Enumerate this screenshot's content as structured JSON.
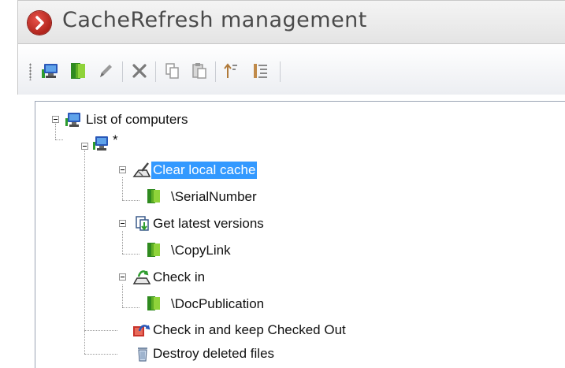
{
  "window": {
    "title": "CacheRefresh management"
  },
  "toolbar": {
    "buttons": [
      {
        "icon": "computer-add-icon"
      },
      {
        "icon": "folder-add-icon"
      },
      {
        "icon": "edit-pencil-icon"
      },
      {
        "icon": "delete-x-icon"
      },
      {
        "icon": "copy-icon"
      },
      {
        "icon": "paste-icon"
      },
      {
        "icon": "sort-up-icon"
      },
      {
        "icon": "list-icon"
      }
    ]
  },
  "tree": {
    "root_label": "List of computers",
    "computer_label": "*",
    "clear_cache_label": "Clear local cache",
    "clear_cache_path": "\\SerialNumber",
    "get_latest_label": "Get latest versions",
    "get_latest_path": "\\CopyLink",
    "check_in_label": "Check in",
    "check_in_path": "\\DocPublication",
    "check_in_keep_label": "Check in and keep Checked Out",
    "destroy_label": "Destroy deleted files"
  },
  "colors": {
    "selection": "#3399ff",
    "title_icon": "#c62a22"
  }
}
